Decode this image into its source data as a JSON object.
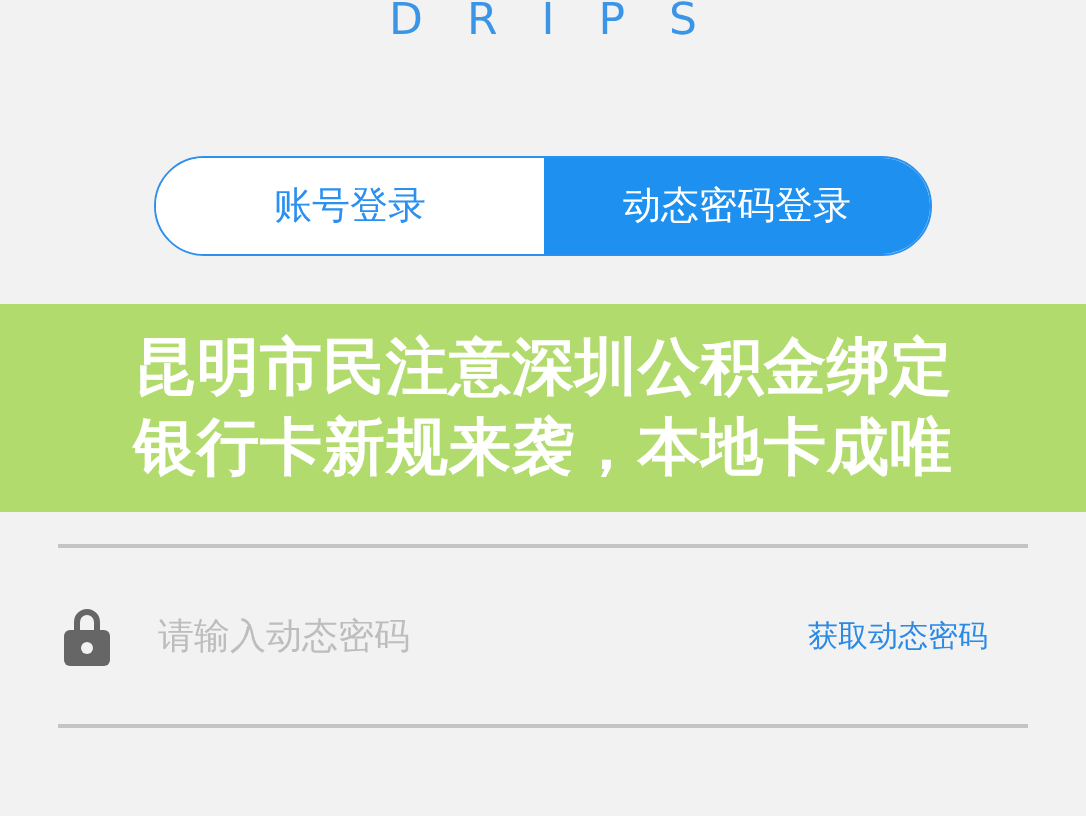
{
  "app": {
    "logo": "DRIPS"
  },
  "tabs": [
    {
      "label": "账号登录",
      "selected": false
    },
    {
      "label": "动态密码登录",
      "selected": true
    }
  ],
  "banner": {
    "lines": [
      "昆明市民注意深圳公积金绑定",
      "银行卡新规来袭，本地卡成唯"
    ]
  },
  "password_field": {
    "placeholder": "请输入动态密码",
    "action": "获取动态密码"
  }
}
